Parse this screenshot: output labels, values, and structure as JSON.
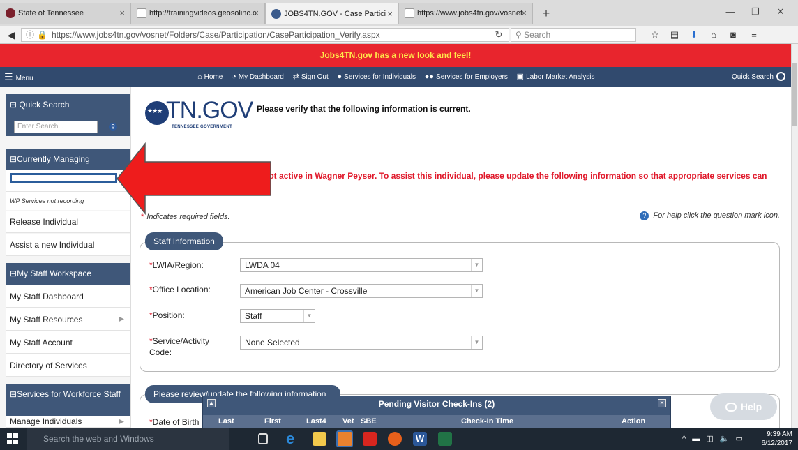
{
  "browser": {
    "tabs": [
      {
        "title": "State of Tennessee",
        "active": false
      },
      {
        "title": "http://trainingvideos.geosolinc.c",
        "active": false
      },
      {
        "title": "JOBS4TN.GOV - Case Partici",
        "active": true
      },
      {
        "title": "https://www.jobs4tn.gov/vosnet",
        "active": false
      }
    ],
    "new_tab_glyph": "+",
    "url": "https://www.jobs4tn.gov/vosnet/Folders/Case/Participation/CaseParticipation_Verify.aspx",
    "search_placeholder": "Search"
  },
  "banner": {
    "text": "Jobs4TN.gov has a new look and feel!",
    "bg_color": "#e8252d",
    "text_color": "#ffe94a"
  },
  "menubar": {
    "menu_label": "Menu",
    "items": [
      {
        "label": "Home",
        "icon": "home-icon"
      },
      {
        "label": "My Dashboard",
        "icon": "dashboard-icon"
      },
      {
        "label": "Sign Out",
        "icon": "sign-out-icon"
      },
      {
        "label": "Services for Individuals",
        "icon": "person-icon"
      },
      {
        "label": "Services for Employers",
        "icon": "people-icon"
      },
      {
        "label": "Labor Market Analysis",
        "icon": "chart-icon"
      }
    ],
    "quick_search_label": "Quick Search"
  },
  "sidebar": {
    "quick_search": {
      "title": "Quick Search",
      "placeholder": "Enter Search..."
    },
    "currently_managing": {
      "title": "Currently Managing",
      "status": "WP Services not recording",
      "items": [
        "Release Individual",
        "Assist a new Individual"
      ]
    },
    "staff_workspace": {
      "title": "My Staff Workspace",
      "items": [
        "My Staff Dashboard",
        "My Staff Resources",
        "My Staff Account",
        "Directory of Services"
      ]
    },
    "workforce": {
      "title": "Services for Workforce Staff",
      "items": [
        "Manage Individuals"
      ]
    }
  },
  "main": {
    "logo_text": "TN.GOV",
    "logo_sub": "TENNESSEE GOVERNMENT",
    "verify_heading": "Please verify that the following information is current.",
    "warning": "not active in Wagner Peyser. To assist this individual, please update the following information so that appropriate services can",
    "required_note": "Indicates required fields.",
    "help_note": "For help click the question mark icon.",
    "staff_info": {
      "legend": "Staff Information",
      "fields": [
        {
          "label": "LWIA/Region:",
          "value": "LWDA 04"
        },
        {
          "label": "Office Location:",
          "value": "American Job Center - Crossville"
        },
        {
          "label": "Position:",
          "value": "Staff"
        },
        {
          "label": "Service/Activity Code:",
          "value": "None Selected"
        }
      ]
    },
    "review": {
      "legend": "Please review/update the following information",
      "dob_label": "Date of Birth"
    }
  },
  "pending": {
    "title": "Pending Visitor Check-Ins (2)",
    "columns": [
      "Last",
      "First",
      "Last4",
      "Vet",
      "SBE",
      "Check-In Time",
      "Action"
    ]
  },
  "help_bubble": {
    "label": "Help"
  },
  "taskbar": {
    "search_placeholder": "Search the web and Windows",
    "time": "9:39 AM",
    "date": "6/12/2017"
  },
  "colors": {
    "nav_blue": "#314a6e",
    "panel_blue": "#3f5779",
    "required_red": "#e0182a",
    "arrow_red": "#ee1c1c"
  }
}
